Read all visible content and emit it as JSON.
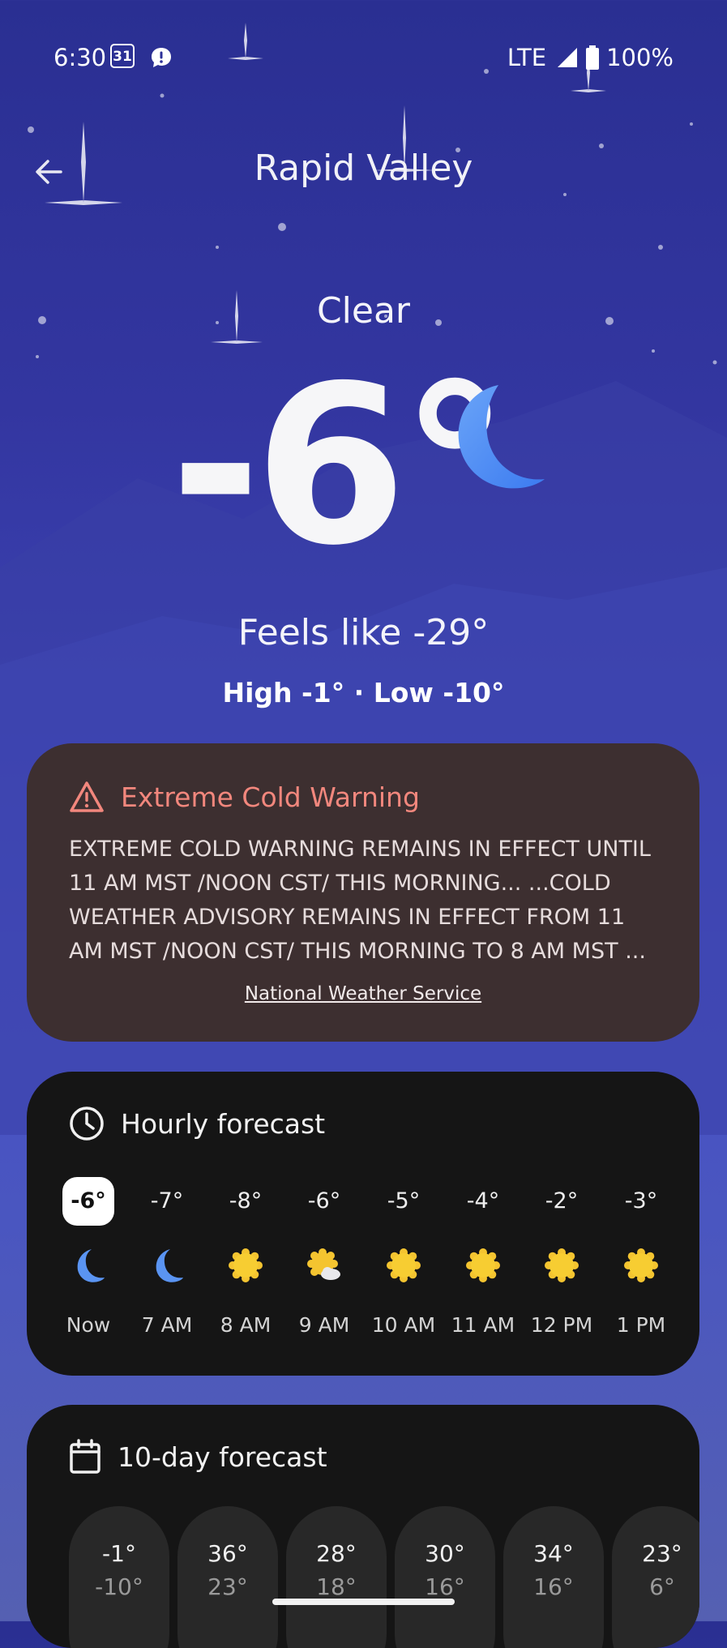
{
  "status_bar": {
    "time": "6:30",
    "calendar_day": "31",
    "network": "LTE",
    "battery": "100%"
  },
  "header": {
    "location": "Rapid Valley"
  },
  "current": {
    "condition": "Clear",
    "temperature": "-6°",
    "feels_like": "Feels like -29°",
    "high_low": "High -1° · Low -10°"
  },
  "alert": {
    "title": "Extreme Cold Warning",
    "body": "EXTREME COLD WARNING REMAINS IN EFFECT UNTIL 11 AM MST /NOON CST/ THIS MORNING... ...COLD WEATHER ADVISORY REMAINS IN EFFECT FROM 11 AM MST /NOON CST/ THIS MORNING TO 8 AM MST ...",
    "source": "National Weather Service",
    "color": "#f2877d"
  },
  "hourly": {
    "title": "Hourly forecast",
    "items": [
      {
        "temp": "-6°",
        "icon": "moon-icon",
        "label": "Now"
      },
      {
        "temp": "-7°",
        "icon": "moon-icon",
        "label": "7 AM"
      },
      {
        "temp": "-8°",
        "icon": "sun-icon",
        "label": "8 AM"
      },
      {
        "temp": "-6°",
        "icon": "sun-cloud-icon",
        "label": "9 AM"
      },
      {
        "temp": "-5°",
        "icon": "sun-icon",
        "label": "10 AM"
      },
      {
        "temp": "-4°",
        "icon": "sun-icon",
        "label": "11 AM"
      },
      {
        "temp": "-2°",
        "icon": "sun-icon",
        "label": "12 PM"
      },
      {
        "temp": "-3°",
        "icon": "sun-icon",
        "label": "1 PM"
      }
    ]
  },
  "ten_day": {
    "title": "10-day forecast",
    "days": [
      {
        "high": "-1°",
        "low": "-10°"
      },
      {
        "high": "36°",
        "low": "23°"
      },
      {
        "high": "28°",
        "low": "18°"
      },
      {
        "high": "30°",
        "low": "16°"
      },
      {
        "high": "34°",
        "low": "16°"
      },
      {
        "high": "23°",
        "low": "6°"
      }
    ]
  }
}
